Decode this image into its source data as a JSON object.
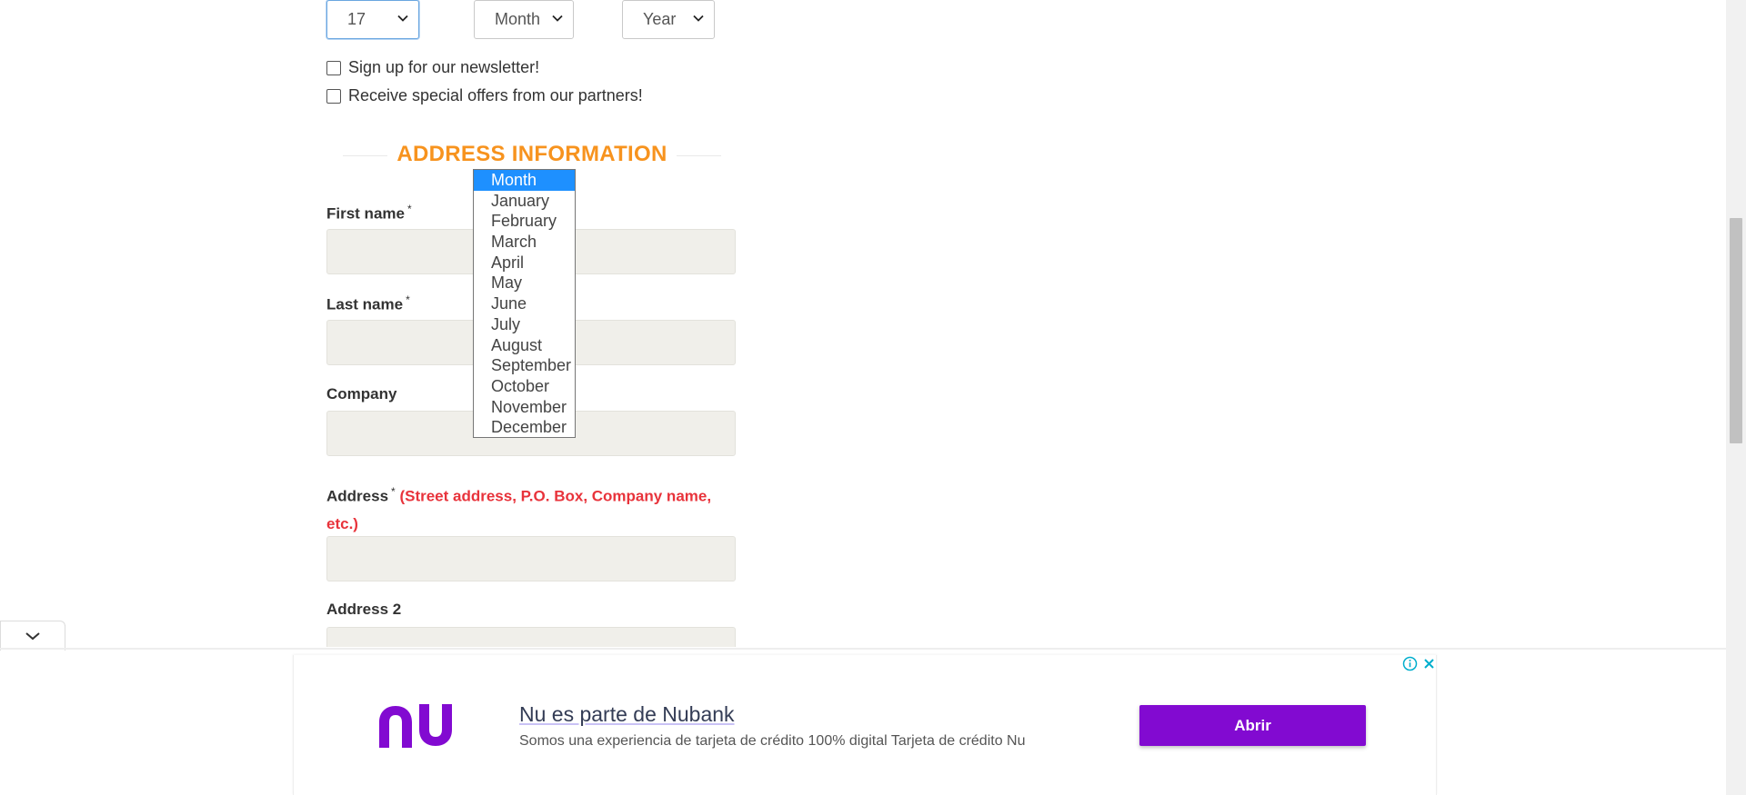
{
  "birthdate": {
    "day": "17",
    "month": "Month",
    "year": "Year"
  },
  "checkboxes": {
    "newsletter": "Sign up for our newsletter!",
    "offers": "Receive special offers from our partners!"
  },
  "section_title": "ADDRESS INFORMATION",
  "fields": {
    "first_name": "First name",
    "last_name": "Last name",
    "company": "Company",
    "address": "Address",
    "address_hint_line1": "(Street address, P.O. Box, Company name,",
    "address_hint_line2": "etc.)",
    "address2": "Address 2",
    "required_marker": "*"
  },
  "month_dropdown": {
    "selected": "Month",
    "options": [
      "Month",
      "January",
      "February",
      "March",
      "April",
      "May",
      "June",
      "July",
      "August",
      "September",
      "October",
      "November",
      "December"
    ]
  },
  "ad": {
    "brand_logo": "nu",
    "title": "Nu es parte de Nubank",
    "description": "Somos una experiencia de tarjeta de crédito 100% digital Tarjeta de crédito Nu",
    "cta": "Abrir"
  },
  "colors": {
    "accent_orange": "#f7931e",
    "hint_red": "#e8333b",
    "selection_blue": "#1e90ff",
    "nubank_purple": "#820ad1",
    "field_bg": "#f0efea"
  },
  "icons": {
    "select_arrow": "chevron-down-icon",
    "collapse": "chevron-down-icon",
    "ad_info": "info-icon",
    "ad_close": "close-icon"
  }
}
